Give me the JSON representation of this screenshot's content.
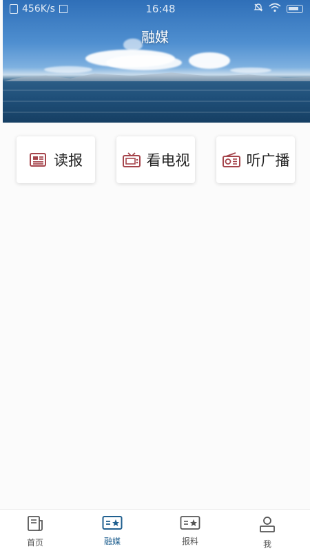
{
  "status_bar": {
    "speed": "456K/s",
    "time": "16:48",
    "battery": "76"
  },
  "header": {
    "title": "融媒"
  },
  "cards": [
    {
      "label": "读报",
      "icon": "newspaper-icon"
    },
    {
      "label": "看电视",
      "icon": "tv-icon"
    },
    {
      "label": "听广播",
      "icon": "radio-icon"
    }
  ],
  "tabbar": {
    "items": [
      {
        "label": "首页",
        "icon": "home-icon"
      },
      {
        "label": "融媒",
        "icon": "media-card-icon",
        "active": true
      },
      {
        "label": "报料",
        "icon": "report-card-icon"
      },
      {
        "label": "我",
        "icon": "person-icon"
      }
    ]
  },
  "colors": {
    "icon_accent": "#a5444b",
    "tab_active": "#1f5f8f"
  }
}
